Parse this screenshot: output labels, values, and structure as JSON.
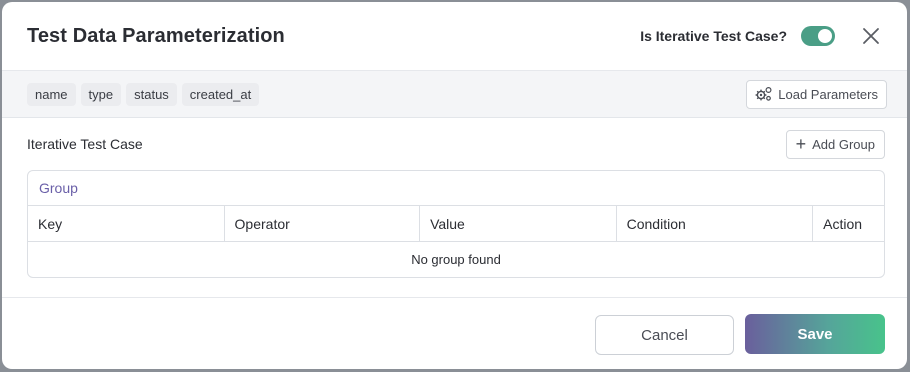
{
  "header": {
    "title": "Test Data Parameterization",
    "iterative_label": "Is Iterative Test Case?",
    "iterative_enabled": true,
    "close_icon": "close-icon"
  },
  "params": {
    "chips": [
      "name",
      "type",
      "status",
      "created_at"
    ],
    "load_label": "Load Parameters",
    "load_icon": "gears-icon"
  },
  "section": {
    "title": "Iterative Test Case",
    "add_label": "Add Group",
    "add_icon": "plus-icon"
  },
  "group": {
    "title": "Group",
    "columns": [
      "Key",
      "Operator",
      "Value",
      "Condition",
      "Action"
    ],
    "empty_text": "No group found"
  },
  "footer": {
    "cancel_label": "Cancel",
    "save_label": "Save"
  },
  "colors": {
    "toggle": "#4a9e86",
    "group_title": "#6a5fa8",
    "save_gradient_start": "#6a5f9c",
    "save_gradient_end": "#48c38b"
  }
}
